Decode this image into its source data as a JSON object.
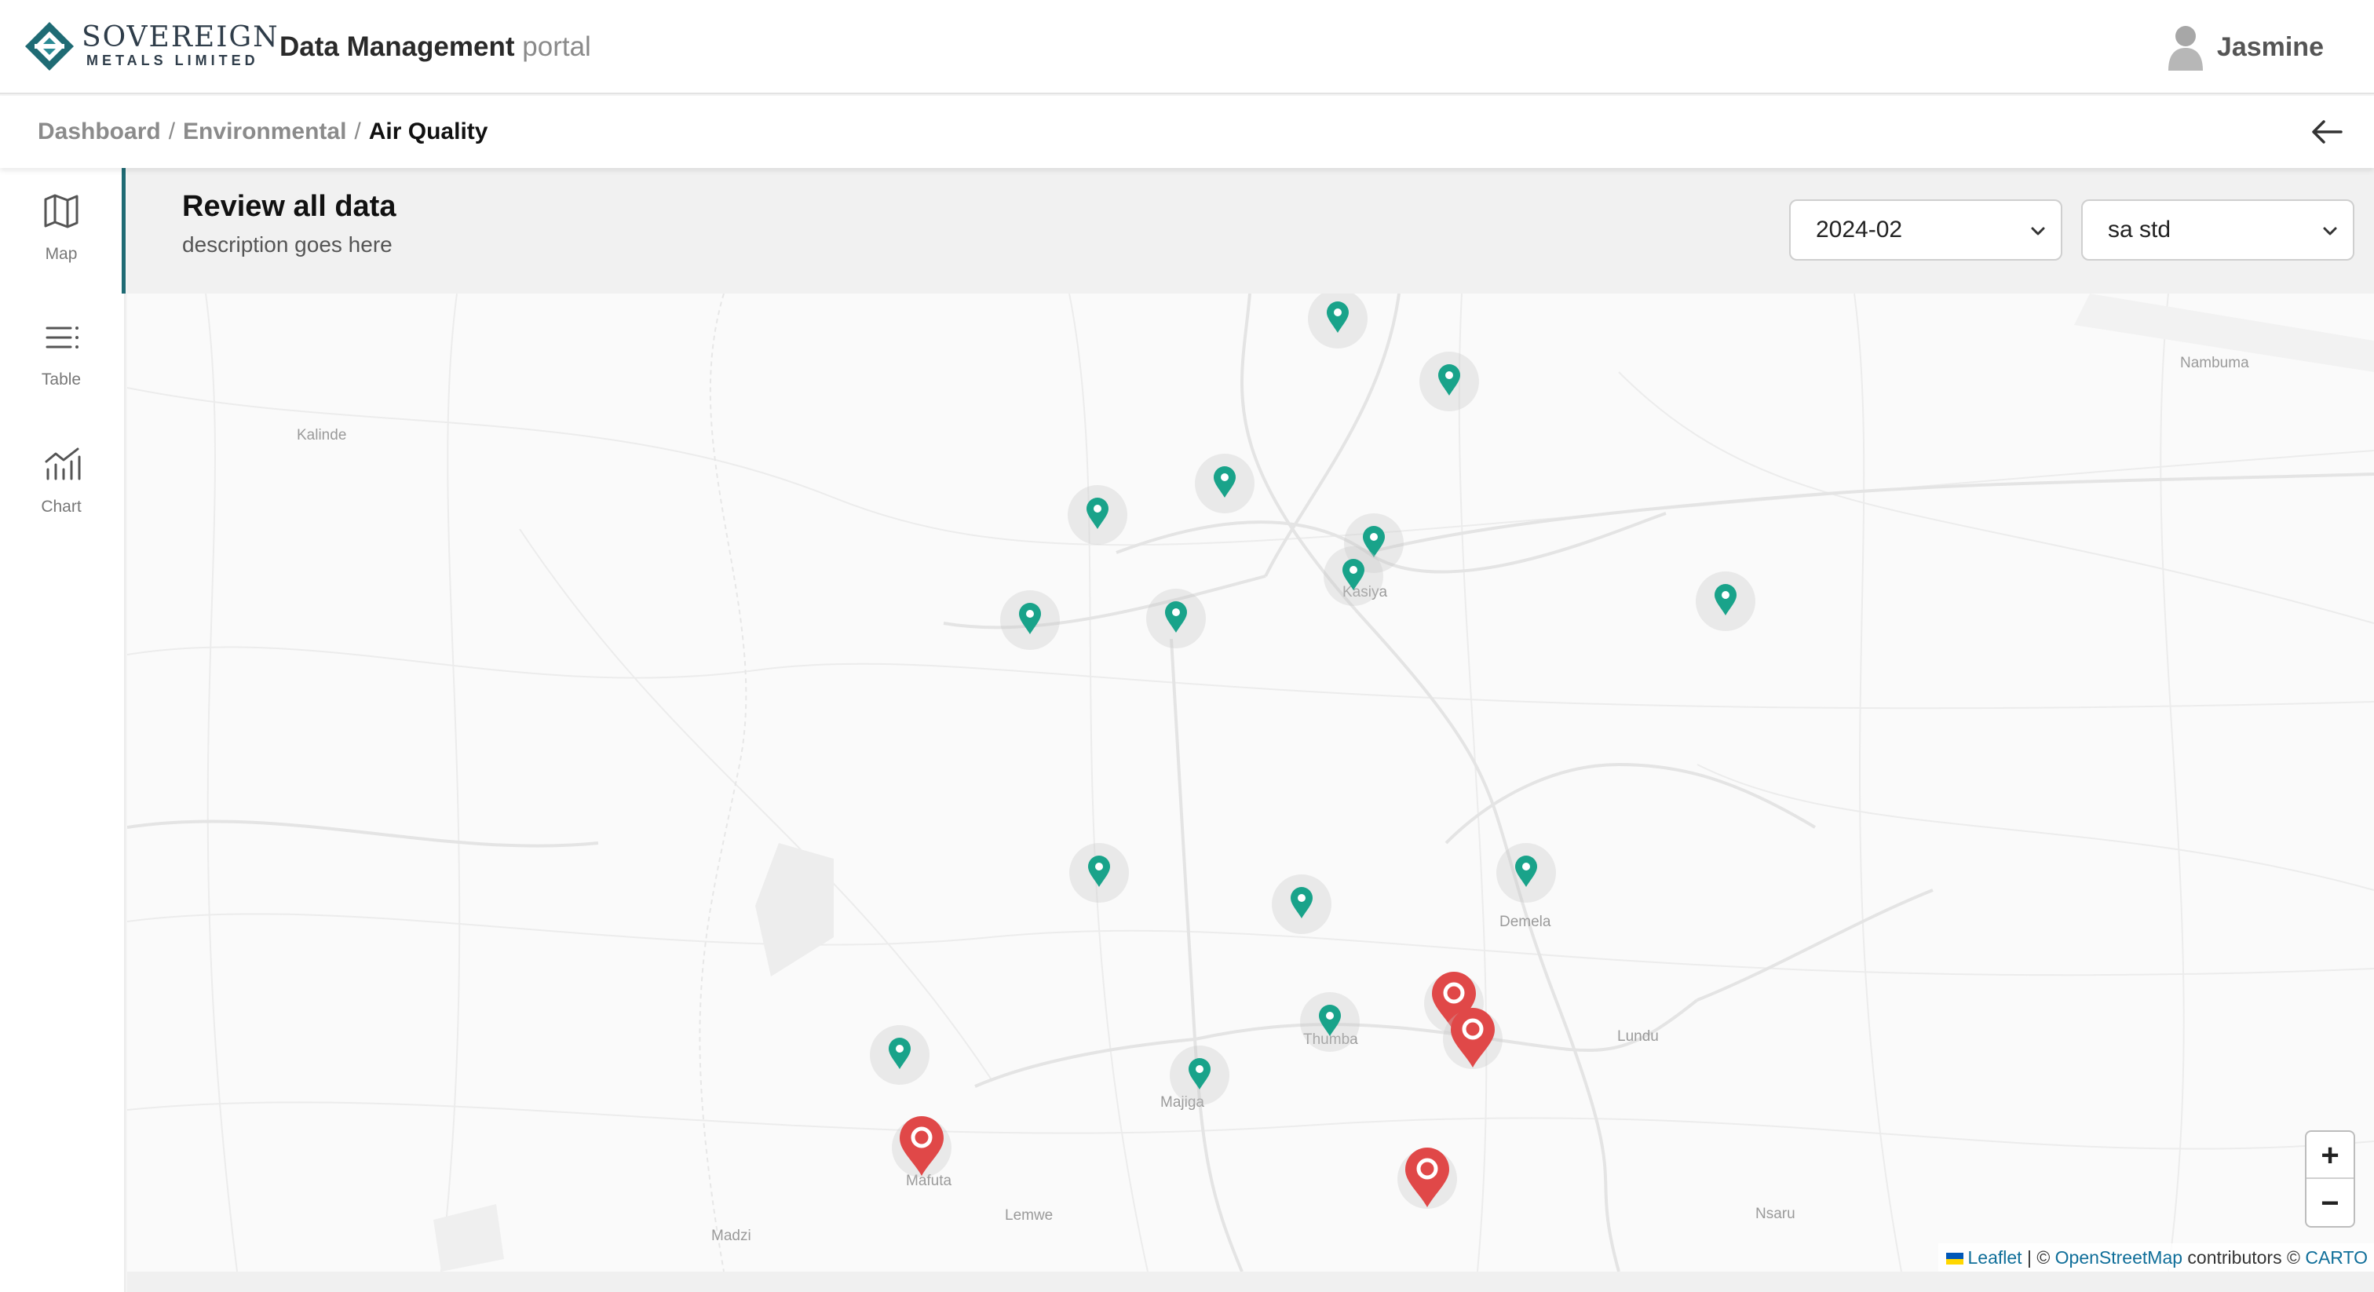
{
  "header": {
    "logo_name": "SOVEREIGN",
    "logo_sub": "METALS LIMITED",
    "app_title_strong": "Data Management",
    "app_title_light": "portal",
    "user_name": "Jasmine",
    "brand_color": "#1f6b74"
  },
  "breadcrumb": {
    "items": [
      "Dashboard",
      "Environmental"
    ],
    "separator": "/",
    "current": "Air Quality"
  },
  "sidebar": {
    "items": [
      {
        "label": "Map",
        "icon": "map-icon",
        "active": true
      },
      {
        "label": "Table",
        "icon": "list-icon",
        "active": false
      },
      {
        "label": "Chart",
        "icon": "chart-icon",
        "active": false
      }
    ]
  },
  "content": {
    "title": "Review all data",
    "description": "description goes here",
    "date_select": {
      "value": "2024-02"
    },
    "standard_select": {
      "value": "sa std"
    }
  },
  "map": {
    "places": [
      "Nambuma",
      "Kalinde",
      "Kasiya",
      "Demela",
      "Lundu",
      "Thumba",
      "Majiga",
      "Mafuta",
      "Lemwe",
      "Madzi",
      "Nsaru"
    ],
    "markers": [
      {
        "status": "within-standard",
        "color": "#19a38a"
      },
      {
        "status": "exceeds-standard",
        "color": "#e04848"
      }
    ],
    "zoom_in_label": "+",
    "zoom_out_label": "−",
    "attribution": {
      "leaflet": "Leaflet",
      "sep": " | © ",
      "osm": "OpenStreetMap",
      "contributors": " contributors © ",
      "carto": "CARTO"
    }
  }
}
